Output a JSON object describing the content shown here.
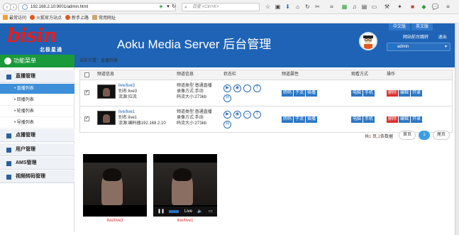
{
  "browser": {
    "url": "192.168.2.10:9001/admin.html",
    "search_placeholder": "百度 <Ctrl+K>",
    "bookmarks": [
      "最常访问",
      "火狐官方站点",
      "新手上路",
      "常用网址"
    ]
  },
  "header": {
    "logo_text": "bisin",
    "logo_sub": "北极星通",
    "title": "Aoku Media Server 后台管理",
    "lang_cn": "中文版",
    "lang_en": "英文版",
    "link_front": "网站前台跳转",
    "link_logout": "退出",
    "user": "admin"
  },
  "sidebar": {
    "title": "功能菜单",
    "groups": [
      {
        "label": "直播管理"
      },
      {
        "label": "点播管理"
      },
      {
        "label": "用户管理"
      },
      {
        "label": "AMS管理"
      },
      {
        "label": "视频转码管理"
      }
    ],
    "items": [
      {
        "label": "直播列表"
      },
      {
        "label": "回播列表"
      },
      {
        "label": "轮播列表"
      },
      {
        "label": "导播列表"
      }
    ]
  },
  "breadcrumb": "当前位置：直播列表",
  "table": {
    "headers": [
      "频道信息",
      "频道信息",
      "状态栏",
      "频道属性",
      "观看方式",
      "操作"
    ],
    "rows": [
      {
        "name": "live/live3",
        "alias": "别名:live3",
        "source": "流源:拉流",
        "type": "频道类型:普通直播",
        "record": "录像方式:手动",
        "bitrate": "码流大小:273kb",
        "attrs": [
          "转码",
          "子流",
          "插播"
        ],
        "watch": [
          "电脑",
          "手机"
        ],
        "ops": [
          "删除",
          "编辑",
          "开录"
        ]
      },
      {
        "name": "live/live1",
        "alias": "别名:live1",
        "source": "流源:编码器192.168.2.10",
        "type": "频道类型:普通直播",
        "record": "录像方式:手动",
        "bitrate": "码流大小:273kb",
        "attrs": [
          "转码",
          "子流",
          "插播"
        ],
        "watch": [
          "电脑",
          "手机"
        ],
        "ops": [
          "删除",
          "编辑",
          "开录"
        ]
      }
    ]
  },
  "pager": {
    "info_prefix": "共",
    "info_pages": "1",
    "info_mid": " 页,",
    "info_count": "2",
    "info_suffix": "条数据",
    "first": "首页",
    "current": "1",
    "last": "尾页"
  },
  "videos": [
    {
      "label": "live/live3"
    },
    {
      "label": "live/live1",
      "live_text": "Live"
    }
  ]
}
